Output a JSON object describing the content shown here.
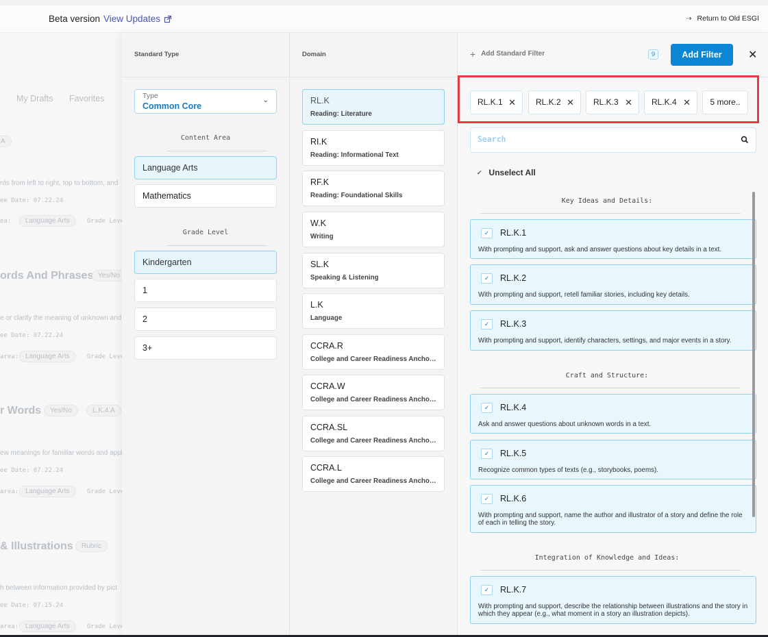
{
  "topbar": {
    "beta_label": "Beta version",
    "view_updates": "View Updates",
    "return_old": "Return to Old ESGI"
  },
  "background": {
    "tabs": [
      "My Drafts",
      "Favorites"
    ],
    "pill_a": "A",
    "items": [
      {
        "title": "ords And Phrases",
        "type": "Yes/No",
        "desc": "e or clarify the meaning of unknown and",
        "meta": "ee Date: 07.22.24",
        "content": "Language Arts",
        "grade": "Grade Leve",
        "area": "area:"
      },
      {
        "title": "r Words",
        "type": "Yes/No",
        "code": "L.K.4.A",
        "desc": "ew meanings for familiar words and appl",
        "meta": "ee Date: 07.22.24",
        "content": "Language Arts",
        "grade": "Grade Leve",
        "area": "area:"
      },
      {
        "title": "& Illustrations",
        "type": "Rubric",
        "desc": "h between information provided by pict",
        "meta": "ee Date: 07.15.24",
        "content": "Language Arts",
        "grade": "Grade Leve",
        "area": "area:"
      }
    ],
    "first_desc": "rds from left to right, top to bottom, and",
    "first_meta": "ee Date: 07.22.24",
    "first_content": "Language Arts",
    "first_grade": "Grade Leve",
    "first_area": "ea:"
  },
  "standard_type": {
    "header": "Standard Type",
    "type_label": "Type",
    "type_value": "Common Core",
    "content_area_label": "Content Area",
    "content_areas": [
      {
        "label": "Language Arts",
        "selected": true
      },
      {
        "label": "Mathematics",
        "selected": false
      }
    ],
    "grade_level_label": "Grade Level",
    "grades": [
      {
        "label": "Kindergarten",
        "selected": true
      },
      {
        "label": "1",
        "selected": false
      },
      {
        "label": "2",
        "selected": false
      },
      {
        "label": "3+",
        "selected": false
      }
    ]
  },
  "domain": {
    "header": "Domain",
    "items": [
      {
        "code": "RL.K",
        "name": "Reading: Literature",
        "selected": true
      },
      {
        "code": "RI.K",
        "name": "Reading: Informational Text",
        "selected": false
      },
      {
        "code": "RF.K",
        "name": "Reading: Foundational Skills",
        "selected": false
      },
      {
        "code": "W.K",
        "name": "Writing",
        "selected": false
      },
      {
        "code": "SL.K",
        "name": "Speaking & Listening",
        "selected": false
      },
      {
        "code": "L.K",
        "name": "Language",
        "selected": false
      },
      {
        "code": "CCRA.R",
        "name": "College and Career Readiness Anchor S...",
        "selected": false
      },
      {
        "code": "CCRA.W",
        "name": "College and Career Readiness Anchor S...",
        "selected": false
      },
      {
        "code": "CCRA.SL",
        "name": "College and Career Readiness Anchor S...",
        "selected": false
      },
      {
        "code": "CCRA.L",
        "name": "College and Career Readiness Anchor S...",
        "selected": false
      }
    ]
  },
  "standards": {
    "add_standard_filter": "Add Standard Filter",
    "count": "9",
    "add_filter_button": "Add Filter",
    "chips": [
      "RL.K.1",
      "RL.K.2",
      "RL.K.3",
      "RL.K.4"
    ],
    "more_chip": "5 more..",
    "search_placeholder": "Search",
    "unselect_all": "Unselect All",
    "groups": [
      {
        "label": "Key Ideas and Details:",
        "items": [
          {
            "code": "RL.K.1",
            "desc": "With prompting and support, ask and answer questions about key details in a text."
          },
          {
            "code": "RL.K.2",
            "desc": "With prompting and support, retell familiar stories, including key details."
          },
          {
            "code": "RL.K.3",
            "desc": "With prompting and support, identify characters, settings, and major events in a story."
          }
        ]
      },
      {
        "label": "Craft and Structure:",
        "items": [
          {
            "code": "RL.K.4",
            "desc": "Ask and answer questions about unknown words in a text."
          },
          {
            "code": "RL.K.5",
            "desc": "Recognize common types of texts (e.g., storybooks, poems)."
          },
          {
            "code": "RL.K.6",
            "desc": "With prompting and support, name the author and illustrator of a story and define the role of each in telling the story."
          }
        ]
      },
      {
        "label": "Integration of Knowledge and Ideas:",
        "items": [
          {
            "code": "RL.K.7",
            "desc": "With prompting and support, describe the relationship between illustrations and the story in which they appear (e.g., what moment in a story an illustration depicts)."
          }
        ]
      }
    ]
  },
  "colors": {
    "accent": "#0a86d4",
    "selected_bg": "#e7f6fd",
    "selected_border": "#8ed0ee",
    "highlight": "#e53b45"
  }
}
